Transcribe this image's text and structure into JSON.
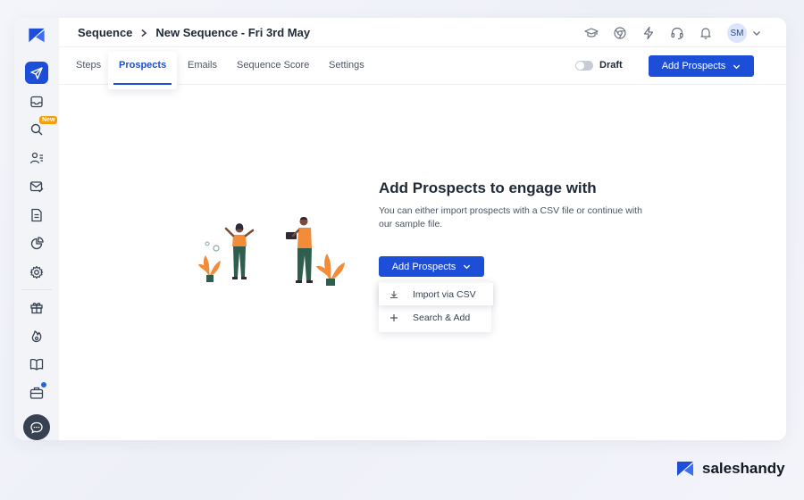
{
  "breadcrumb": {
    "root": "Sequence",
    "current": "New Sequence - Fri 3rd May"
  },
  "header": {
    "avatar_initials": "SM"
  },
  "tabs": [
    "Steps",
    "Prospects",
    "Emails",
    "Sequence Score",
    "Settings"
  ],
  "active_tab": "Prospects",
  "status_toggle": {
    "label": "Draft",
    "on": false
  },
  "top_add_button": {
    "label": "Add Prospects"
  },
  "sidebar": {
    "new_badge": "New"
  },
  "empty_state": {
    "title": "Add Prospects to engage with",
    "description": "You can either import prospects with a CSV file or continue with our sample file.",
    "button_label": "Add Prospects"
  },
  "dropdown": {
    "items": [
      "Import via CSV",
      "Search & Add"
    ]
  },
  "brand": {
    "name": "saleshandy"
  },
  "colors": {
    "accent": "#1d4ed8",
    "illustration_orange": "#f28c38",
    "illustration_green": "#2f5e4e"
  },
  "icons": {
    "sidebar": [
      "send-icon",
      "inbox-icon",
      "search-icon",
      "contacts-icon",
      "mail-check-icon",
      "document-icon",
      "pie-chart-icon",
      "settings-icon",
      "gift-icon",
      "fire-icon",
      "book-icon",
      "briefcase-icon",
      "chat-icon"
    ],
    "top": [
      "graduation-cap-icon",
      "chrome-icon",
      "lightning-icon",
      "headset-icon",
      "bell-icon",
      "chevron-down-icon"
    ]
  }
}
